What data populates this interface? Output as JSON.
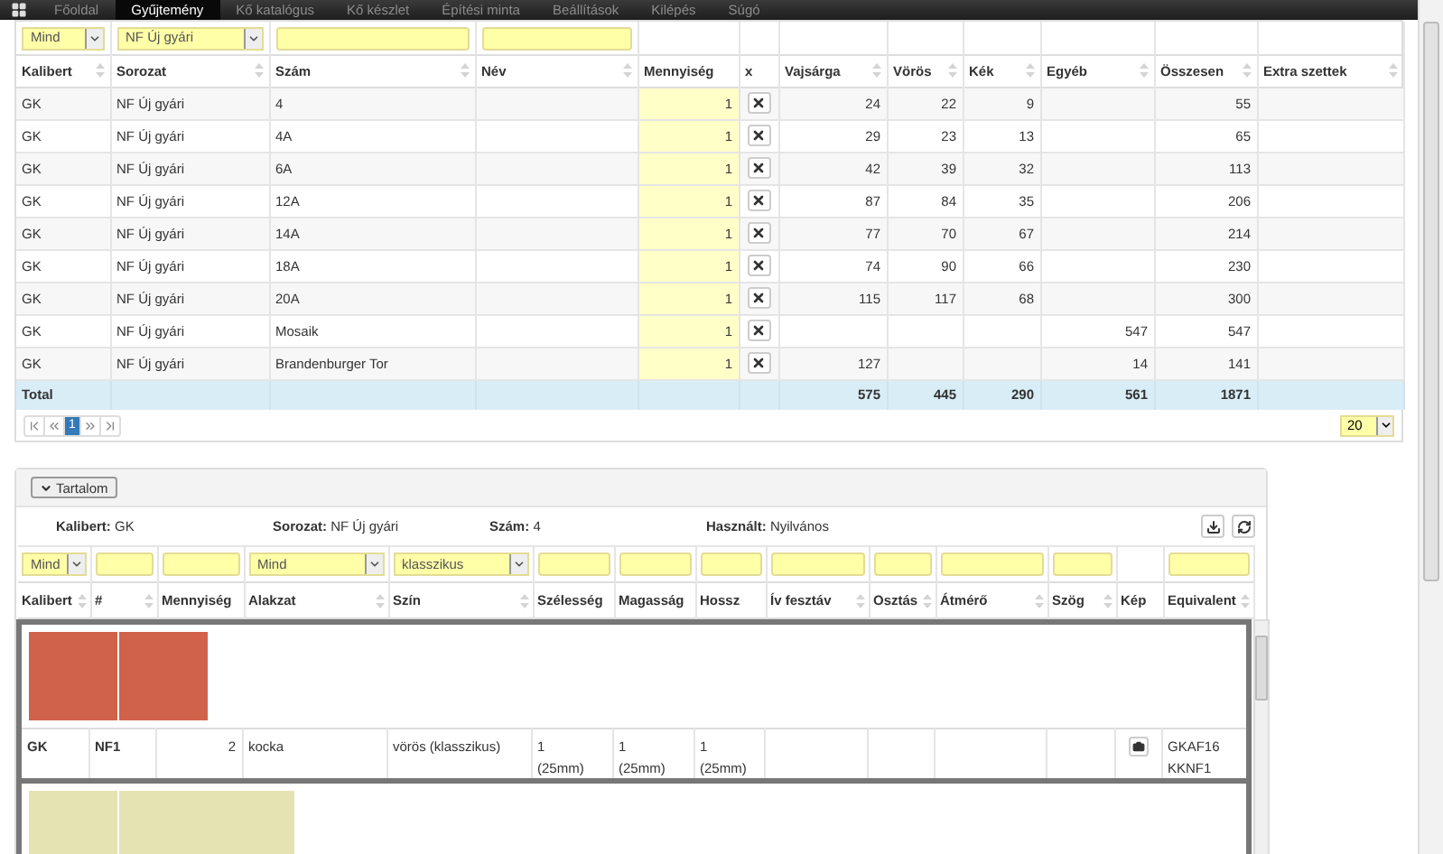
{
  "nav": {
    "items": [
      {
        "label": "Főoldal",
        "selected": false
      },
      {
        "label": "Gyűjtemény",
        "selected": true
      },
      {
        "label": "Kő katalógus",
        "selected": false
      },
      {
        "label": "Kő készlet",
        "selected": false
      },
      {
        "label": "Építési minta",
        "selected": false
      },
      {
        "label": "Beállítások",
        "selected": false
      },
      {
        "label": "Kilépés",
        "selected": false
      },
      {
        "label": "Súgó",
        "selected": false
      }
    ]
  },
  "collection_table": {
    "columns": [
      {
        "label": "Kalibert",
        "kind": "text",
        "sortable": true,
        "filter": {
          "kind": "select",
          "value": "Mind"
        }
      },
      {
        "label": "Sorozat",
        "kind": "text",
        "sortable": true,
        "filter": {
          "kind": "select",
          "value": "NF Új gyári"
        }
      },
      {
        "label": "Szám",
        "kind": "text",
        "sortable": true,
        "filter": {
          "kind": "input"
        }
      },
      {
        "label": "Név",
        "kind": "text",
        "sortable": true,
        "filter": {
          "kind": "input"
        }
      },
      {
        "label": "Mennyiség",
        "kind": "quantity",
        "sortable": false
      },
      {
        "label": "x",
        "kind": "delete",
        "sortable": false
      },
      {
        "label": "Vajsárga",
        "kind": "number",
        "sortable": true
      },
      {
        "label": "Vörös",
        "kind": "number",
        "sortable": true
      },
      {
        "label": "Kék",
        "kind": "number",
        "sortable": true
      },
      {
        "label": "Egyéb",
        "kind": "number",
        "sortable": true
      },
      {
        "label": "Összesen",
        "kind": "number",
        "sortable": true
      },
      {
        "label": "Extra szettek",
        "kind": "text",
        "sortable": true
      }
    ],
    "rows": [
      {
        "kalibert": "GK",
        "sorozat": "NF Új gyári",
        "szam": "4",
        "mennyiseg": "1",
        "vajsarga": "24",
        "voros": "22",
        "kek": "9",
        "osszesen": "55"
      },
      {
        "kalibert": "GK",
        "sorozat": "NF Új gyári",
        "szam": "4A",
        "mennyiseg": "1",
        "vajsarga": "29",
        "voros": "23",
        "kek": "13",
        "osszesen": "65"
      },
      {
        "kalibert": "GK",
        "sorozat": "NF Új gyári",
        "szam": "6A",
        "mennyiseg": "1",
        "vajsarga": "42",
        "voros": "39",
        "kek": "32",
        "osszesen": "113"
      },
      {
        "kalibert": "GK",
        "sorozat": "NF Új gyári",
        "szam": "12A",
        "mennyiseg": "1",
        "vajsarga": "87",
        "voros": "84",
        "kek": "35",
        "osszesen": "206"
      },
      {
        "kalibert": "GK",
        "sorozat": "NF Új gyári",
        "szam": "14A",
        "mennyiseg": "1",
        "vajsarga": "77",
        "voros": "70",
        "kek": "67",
        "osszesen": "214"
      },
      {
        "kalibert": "GK",
        "sorozat": "NF Új gyári",
        "szam": "18A",
        "mennyiseg": "1",
        "vajsarga": "74",
        "voros": "90",
        "kek": "66",
        "osszesen": "230"
      },
      {
        "kalibert": "GK",
        "sorozat": "NF Új gyári",
        "szam": "20A",
        "mennyiseg": "1",
        "vajsarga": "115",
        "voros": "117",
        "kek": "68",
        "osszesen": "300"
      },
      {
        "kalibert": "GK",
        "sorozat": "NF Új gyári",
        "szam": "Mosaik",
        "mennyiseg": "1",
        "egyeb": "547",
        "osszesen": "547"
      },
      {
        "kalibert": "GK",
        "sorozat": "NF Új gyári",
        "szam": "Brandenburger Tor",
        "mennyiseg": "1",
        "vajsarga": "127",
        "egyeb": "14",
        "osszesen": "141"
      }
    ],
    "total": {
      "kalibert": "Total",
      "vajsarga": "575",
      "voros": "445",
      "kek": "290",
      "egyeb": "561",
      "osszesen": "1871"
    },
    "pager": {
      "pages": [
        {
          "label": "1",
          "selected": true
        }
      ],
      "page_size": "20"
    }
  },
  "content_panel": {
    "toggle": "Tartalom",
    "info": [
      {
        "label": "Kalibert:",
        "value": "GK"
      },
      {
        "label": "Sorozat:",
        "value": "NF Új gyári"
      },
      {
        "label": "Szám:",
        "value": "4"
      },
      {
        "label": "Használt:",
        "value": "Nyilvános"
      }
    ],
    "columns": [
      {
        "label": "Kalibert",
        "kind": "bold",
        "sortable": true,
        "filter": {
          "kind": "select",
          "value": "Mind"
        }
      },
      {
        "label": "#",
        "kind": "bold",
        "sortable": true,
        "filter": {
          "kind": "input"
        }
      },
      {
        "label": "Mennyiség",
        "kind": "number",
        "sortable": false,
        "filter": {
          "kind": "input"
        }
      },
      {
        "label": "Alakzat",
        "kind": "text",
        "sortable": true,
        "filter": {
          "kind": "select",
          "value": "Mind"
        }
      },
      {
        "label": "Szín",
        "kind": "text",
        "sortable": true,
        "filter": {
          "kind": "select",
          "value": "klasszikus"
        }
      },
      {
        "label": "Szélesség",
        "kind": "text",
        "sortable": false,
        "filter": {
          "kind": "input"
        }
      },
      {
        "label": "Magasság",
        "kind": "text",
        "sortable": false,
        "filter": {
          "kind": "input"
        }
      },
      {
        "label": "Hossz",
        "kind": "text",
        "sortable": false,
        "filter": {
          "kind": "input"
        }
      },
      {
        "label": "Ív fesztáv",
        "kind": "text",
        "sortable": true,
        "filter": {
          "kind": "input"
        }
      },
      {
        "label": "Osztás",
        "kind": "text",
        "sortable": true,
        "filter": {
          "kind": "input"
        }
      },
      {
        "label": "Átmérő",
        "kind": "text",
        "sortable": true,
        "filter": {
          "kind": "input"
        }
      },
      {
        "label": "Szög",
        "kind": "text",
        "sortable": true,
        "filter": {
          "kind": "input"
        }
      },
      {
        "label": "Kép",
        "kind": "image",
        "sortable": false
      },
      {
        "label": "Equivalent",
        "kind": "text",
        "sortable": true,
        "filter": {
          "kind": "input"
        }
      }
    ],
    "items": [
      {
        "pieces": [
          {
            "kind": "square",
            "color": "#d0614b"
          },
          {
            "kind": "square",
            "color": "#d0614b"
          }
        ],
        "photo": true,
        "row": {
          "kalibert": [
            "GK"
          ],
          "num": [
            "NF1"
          ],
          "mennyiseg": [
            "2"
          ],
          "alakzat": [
            "kocka"
          ],
          "szin": [
            "vörös (klasszikus)"
          ],
          "szelesseg": [
            "1",
            "(25mm)"
          ],
          "magassag": [
            "1",
            "(25mm)"
          ],
          "hossz": [
            "1",
            "(25mm)"
          ],
          "equivalent": [
            "GKAF16",
            "KKNF1"
          ]
        }
      },
      {
        "pieces": [
          {
            "kind": "square",
            "color": "#e6e3b3"
          },
          {
            "kind": "wide",
            "color": "#e6e3b3"
          }
        ]
      }
    ]
  }
}
